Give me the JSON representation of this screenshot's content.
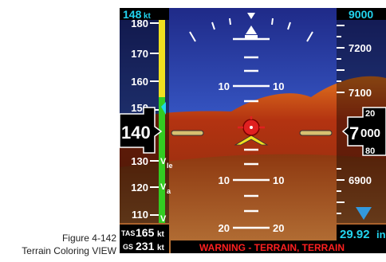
{
  "caption": {
    "line1": "Figure 4-142",
    "line2": "Terrain Coloring VIEW"
  },
  "speed_tape": {
    "selected": "148",
    "selected_unit": "kt",
    "ticks": [
      "180",
      "170",
      "160",
      "150",
      "130",
      "120",
      "110"
    ],
    "current": "140",
    "vspeeds": [
      {
        "label": "V",
        "sub": "le"
      },
      {
        "label": "V",
        "sub": "a"
      },
      {
        "label": "V",
        "sub": ""
      }
    ],
    "tas_label": "TAS",
    "tas_value": "165",
    "tas_unit": "kt",
    "gs_label": "GS",
    "gs_value": "231",
    "gs_unit": "kt"
  },
  "altitude_tape": {
    "selected": "9000",
    "ticks": [
      "7200",
      "7100",
      "6900"
    ],
    "current_prefix": "7",
    "current_digits": "000",
    "roller_top": "20",
    "roller_bottom": "80",
    "baro_value": "29.92",
    "baro_unit": "in"
  },
  "attitude": {
    "pitch_labels_upper": [
      "10",
      "10"
    ],
    "pitch_labels_lower": [
      "10",
      "10",
      "20",
      "20"
    ]
  },
  "warning": {
    "text": "WARNING - TERRAIN, TERRAIN"
  },
  "colors": {
    "sky_top": "#1f2a88",
    "sky_bottom": "#5f86e8",
    "terrain": "#b33311",
    "terrain_light": "#e0721e",
    "ground": "#8a4a12",
    "speed_band_yellow": "#f0e020",
    "speed_band_green": "#33cc22",
    "cyan": "#22d4ee",
    "warning": "#ff2020"
  }
}
